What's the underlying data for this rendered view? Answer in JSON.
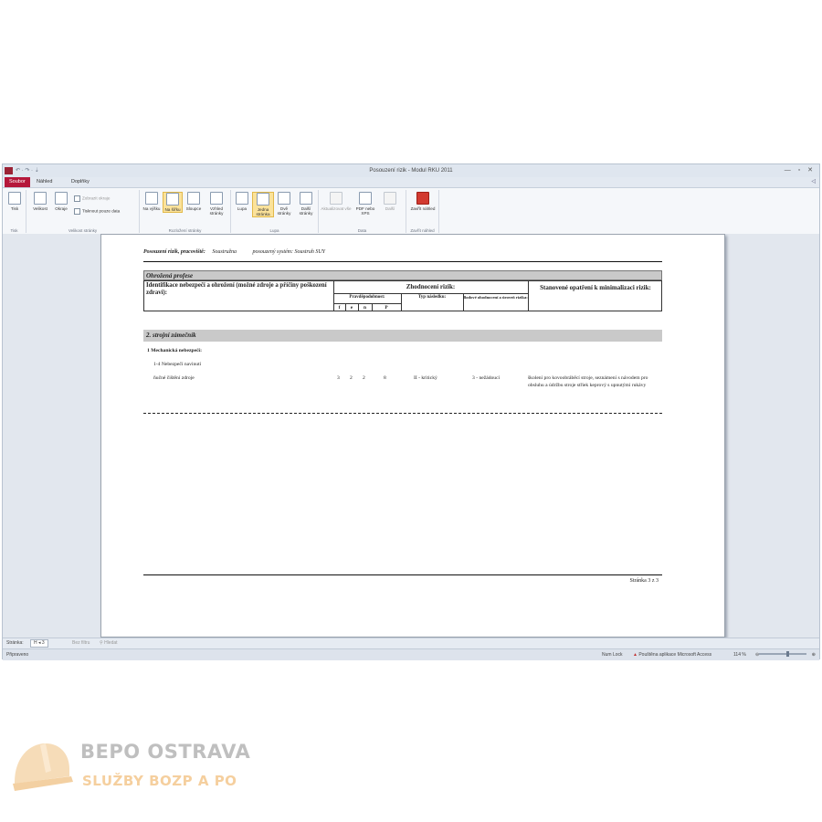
{
  "window": {
    "title": "Posouzení rizik - Modul RKU 2011",
    "controls": "— ▫ ✕"
  },
  "tabs": [
    "Soubor",
    "Náhled",
    "Doplňky"
  ],
  "ribbon": {
    "groups": [
      {
        "label": "Tisk",
        "buttons": [
          "Tisk"
        ]
      },
      {
        "label": "Velikost stránky",
        "buttons": [
          "Velikost",
          "Okraje"
        ],
        "checks": [
          "Zobrazit okraje",
          "Tisknout pouze data"
        ]
      },
      {
        "label": "Rozložení stránky",
        "buttons": [
          "Na výšku",
          "Na šířku",
          "Sloupce",
          "Vzhled stránky"
        ]
      },
      {
        "label": "Lupa",
        "buttons": [
          "Lupa",
          "Jedna stránka",
          "Dvě stránky",
          "Další stránky"
        ]
      },
      {
        "label": "Data",
        "buttons": [
          "Aktualizovat vše",
          "PDF nebo XPS",
          "Další"
        ]
      },
      {
        "label": "Zavřít náhled",
        "buttons": [
          "Zavřít náhled"
        ]
      }
    ]
  },
  "report": {
    "header_label": "Posouzení rizik, pracoviště:",
    "header_value": "Soustružna",
    "header_system": "posouzený systém: Soustruh SUY",
    "band_title": "Ohrožená profese",
    "col1": "Identifikace nebezpečí a ohrožení (možné zdroje a příčiny poškození zdraví):",
    "col2": "Zhodnocení rizik:",
    "col2_sub1": "Pravděpodobnost:",
    "col2_sub2": "Typ následku:",
    "col2_sub3": "Bodové ohodnocení a úroveň rizika:",
    "col3": "Stanovené opatření k minimalizaci rizik:",
    "sub_f": "f",
    "sub_e": "e",
    "sub_n": "n",
    "sub_p": "P",
    "section": "2.   strojní zámečník",
    "group": "1  Mechanická nebezpečí:",
    "hazard": "1-4 Nebezpečí navinutí",
    "row": {
      "desc": "ňučné čištění zdroje",
      "f": "3",
      "e": "2",
      "n": "2",
      "p": "8",
      "typ": "II - kritický",
      "uroven": "3 - nežádoucí",
      "opatreni": "školení pro kovoobráběcí stroje, seznámení s návodem pro obsluhu a údržbu stroje střiek keprový s upnutými rukávy"
    },
    "page_number": "Stránka 3 z  3"
  },
  "navbar": {
    "label": "Stránka:",
    "value": "H  ◂  3",
    "filter": "Bez filtru",
    "search": "Hledat"
  },
  "statusbar": {
    "left": "Připraveno",
    "num_lock": "Num Lock",
    "warning": "Pouštěna aplikace Microsoft Access",
    "zoom": "114 %"
  },
  "watermark": {
    "brand": "BEPO OSTRAVA",
    "tagline": "SLUŽBY BOZP A PO"
  }
}
